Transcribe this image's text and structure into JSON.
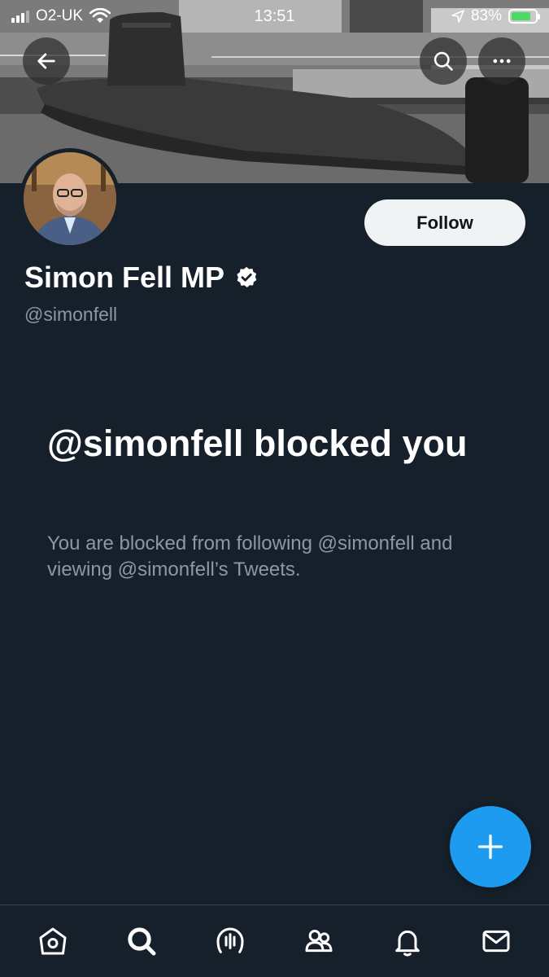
{
  "status_bar": {
    "carrier": "O2-UK",
    "time": "13:51",
    "battery": "83%",
    "battery_level": 0.83
  },
  "header": {
    "back_icon": "arrow-left-icon",
    "search_icon": "search-icon",
    "more_icon": "more-horizontal-icon"
  },
  "profile": {
    "display_name": "Simon Fell MP",
    "handle": "@simonfell",
    "verified": true,
    "follow_label": "Follow"
  },
  "blocked": {
    "title": "@simonfell blocked you",
    "description": "You are blocked from following @simonfell and viewing @simonfell’s Tweets."
  },
  "fab": {
    "icon": "plus-icon"
  },
  "tab_bar": {
    "items": [
      {
        "name": "home",
        "icon": "home-icon"
      },
      {
        "name": "search",
        "icon": "search-icon"
      },
      {
        "name": "spaces",
        "icon": "spaces-icon"
      },
      {
        "name": "communities",
        "icon": "communities-icon"
      },
      {
        "name": "notifications",
        "icon": "bell-icon"
      },
      {
        "name": "messages",
        "icon": "mail-icon"
      }
    ]
  },
  "colors": {
    "background": "#15202b",
    "accent": "#1d9bf0",
    "secondary_text": "#8b98a5",
    "follow_button": "#eff3f4"
  }
}
